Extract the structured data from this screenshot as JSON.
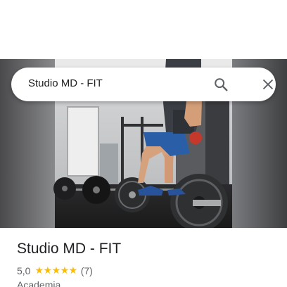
{
  "search": {
    "query": "Studio MD - FIT"
  },
  "place": {
    "name": "Studio MD - FIT",
    "rating": "5,0",
    "stars": "★★★★★",
    "review_count": "(7)",
    "category": "Academia"
  },
  "colors": {
    "star": "#fbbc04",
    "text_primary": "#202124",
    "text_secondary": "#5f6368"
  },
  "icons": {
    "search": "search-icon",
    "close": "close-icon"
  }
}
